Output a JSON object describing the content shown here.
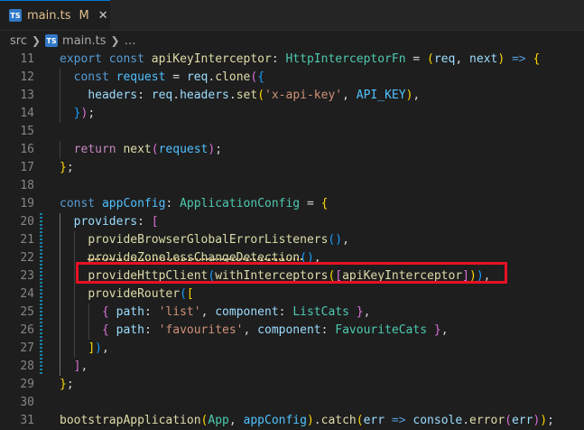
{
  "tab": {
    "icon": "TS",
    "filename": "main.ts",
    "status": "M",
    "close": "✕"
  },
  "breadcrumb": {
    "folder": "src",
    "file": "main.ts",
    "rest": "…",
    "sep": "❯"
  },
  "colors": {
    "highlight_box": "#e81123",
    "tab_modified": "#e2c08d",
    "gutter_modified": "#1b81a8"
  },
  "lines": [
    {
      "n": "11",
      "tokens": [
        [
          "kw",
          "export"
        ],
        [
          "p",
          " "
        ],
        [
          "kw",
          "const"
        ],
        [
          "p",
          " "
        ],
        [
          "fn",
          "apiKeyInterceptor"
        ],
        [
          "p",
          ": "
        ],
        [
          "type",
          "HttpInterceptorFn"
        ],
        [
          "p",
          " = "
        ],
        [
          "b1",
          "("
        ],
        [
          "var",
          "req"
        ],
        [
          "p",
          ", "
        ],
        [
          "var",
          "next"
        ],
        [
          "b1",
          ")"
        ],
        [
          "p",
          " "
        ],
        [
          "kw",
          "=>"
        ],
        [
          "p",
          " "
        ],
        [
          "b1",
          "{"
        ]
      ]
    },
    {
      "n": "12",
      "tokens": [
        [
          "p",
          "  "
        ],
        [
          "kw",
          "const"
        ],
        [
          "p",
          " "
        ],
        [
          "cst",
          "request"
        ],
        [
          "p",
          " = "
        ],
        [
          "var",
          "req"
        ],
        [
          "p",
          "."
        ],
        [
          "fn",
          "clone"
        ],
        [
          "b2",
          "("
        ],
        [
          "b3",
          "{"
        ]
      ]
    },
    {
      "n": "13",
      "tokens": [
        [
          "p",
          "    "
        ],
        [
          "var",
          "headers"
        ],
        [
          "p",
          ": "
        ],
        [
          "var",
          "req"
        ],
        [
          "p",
          "."
        ],
        [
          "var",
          "headers"
        ],
        [
          "p",
          "."
        ],
        [
          "fn",
          "set"
        ],
        [
          "b1",
          "("
        ],
        [
          "str",
          "'x-api-key'"
        ],
        [
          "p",
          ", "
        ],
        [
          "cst",
          "API_KEY"
        ],
        [
          "b1",
          ")"
        ],
        [
          "p",
          ","
        ]
      ]
    },
    {
      "n": "14",
      "tokens": [
        [
          "p",
          "  "
        ],
        [
          "b3",
          "}"
        ],
        [
          "b2",
          ")"
        ],
        [
          "p",
          ";"
        ]
      ]
    },
    {
      "n": "15",
      "tokens": []
    },
    {
      "n": "16",
      "tokens": [
        [
          "p",
          "  "
        ],
        [
          "ctl",
          "return"
        ],
        [
          "p",
          " "
        ],
        [
          "fn",
          "next"
        ],
        [
          "b2",
          "("
        ],
        [
          "cst",
          "request"
        ],
        [
          "b2",
          ")"
        ],
        [
          "p",
          ";"
        ]
      ]
    },
    {
      "n": "17",
      "tokens": [
        [
          "b1",
          "}"
        ],
        [
          "p",
          ";"
        ]
      ]
    },
    {
      "n": "18",
      "tokens": []
    },
    {
      "n": "19",
      "tokens": [
        [
          "kw",
          "const"
        ],
        [
          "p",
          " "
        ],
        [
          "cst",
          "appConfig"
        ],
        [
          "p",
          ": "
        ],
        [
          "type",
          "ApplicationConfig"
        ],
        [
          "p",
          " = "
        ],
        [
          "b1",
          "{"
        ]
      ]
    },
    {
      "n": "20",
      "tokens": [
        [
          "p",
          "  "
        ],
        [
          "var",
          "providers"
        ],
        [
          "p",
          ": "
        ],
        [
          "b2",
          "["
        ]
      ]
    },
    {
      "n": "21",
      "tokens": [
        [
          "p",
          "    "
        ],
        [
          "fn",
          "provideBrowserGlobalErrorListeners"
        ],
        [
          "b3",
          "()"
        ],
        [
          "p",
          ","
        ]
      ]
    },
    {
      "n": "22",
      "tokens": [
        [
          "p",
          "    "
        ],
        [
          "fn",
          "provideZonelessChangeDetection"
        ],
        [
          "b3",
          "()"
        ],
        [
          "p",
          ","
        ]
      ]
    },
    {
      "n": "23",
      "tokens": [
        [
          "p",
          "    "
        ],
        [
          "fn",
          "provideHttpClient"
        ],
        [
          "b3",
          "("
        ],
        [
          "fn",
          "withInterceptors"
        ],
        [
          "b1",
          "("
        ],
        [
          "b2",
          "["
        ],
        [
          "fn",
          "apiKeyInterceptor"
        ],
        [
          "b2",
          "]"
        ],
        [
          "b1",
          ")"
        ],
        [
          "b3",
          ")"
        ],
        [
          "p",
          ","
        ]
      ]
    },
    {
      "n": "24",
      "tokens": [
        [
          "p",
          "    "
        ],
        [
          "fn",
          "provideRouter"
        ],
        [
          "b3",
          "("
        ],
        [
          "b1",
          "["
        ]
      ]
    },
    {
      "n": "25",
      "tokens": [
        [
          "p",
          "      "
        ],
        [
          "b2",
          "{"
        ],
        [
          "p",
          " "
        ],
        [
          "var",
          "path"
        ],
        [
          "p",
          ": "
        ],
        [
          "str",
          "'list'"
        ],
        [
          "p",
          ", "
        ],
        [
          "var",
          "component"
        ],
        [
          "p",
          ": "
        ],
        [
          "type",
          "ListCats"
        ],
        [
          "p",
          " "
        ],
        [
          "b2",
          "}"
        ],
        [
          "p",
          ","
        ]
      ]
    },
    {
      "n": "26",
      "tokens": [
        [
          "p",
          "      "
        ],
        [
          "b2",
          "{"
        ],
        [
          "p",
          " "
        ],
        [
          "var",
          "path"
        ],
        [
          "p",
          ": "
        ],
        [
          "str",
          "'favourites'"
        ],
        [
          "p",
          ", "
        ],
        [
          "var",
          "component"
        ],
        [
          "p",
          ": "
        ],
        [
          "type",
          "FavouriteCats"
        ],
        [
          "p",
          " "
        ],
        [
          "b2",
          "}"
        ],
        [
          "p",
          ","
        ]
      ]
    },
    {
      "n": "27",
      "tokens": [
        [
          "p",
          "    "
        ],
        [
          "b1",
          "]"
        ],
        [
          "b3",
          ")"
        ],
        [
          "p",
          ","
        ]
      ]
    },
    {
      "n": "28",
      "tokens": [
        [
          "p",
          "  "
        ],
        [
          "b2",
          "]"
        ],
        [
          "p",
          ","
        ]
      ]
    },
    {
      "n": "29",
      "tokens": [
        [
          "b1",
          "}"
        ],
        [
          "p",
          ";"
        ]
      ]
    },
    {
      "n": "30",
      "tokens": []
    },
    {
      "n": "31",
      "tokens": [
        [
          "fn",
          "bootstrapApplication"
        ],
        [
          "b1",
          "("
        ],
        [
          "type",
          "App"
        ],
        [
          "p",
          ", "
        ],
        [
          "cst",
          "appConfig"
        ],
        [
          "b1",
          ")"
        ],
        [
          "p",
          "."
        ],
        [
          "fn",
          "catch"
        ],
        [
          "b1",
          "("
        ],
        [
          "var",
          "err"
        ],
        [
          "p",
          " "
        ],
        [
          "kw",
          "=>"
        ],
        [
          "p",
          " "
        ],
        [
          "var",
          "console"
        ],
        [
          "p",
          "."
        ],
        [
          "fn",
          "error"
        ],
        [
          "b2",
          "("
        ],
        [
          "var",
          "err"
        ],
        [
          "b2",
          ")"
        ],
        [
          "b1",
          ")"
        ],
        [
          "p",
          ";"
        ]
      ]
    }
  ]
}
